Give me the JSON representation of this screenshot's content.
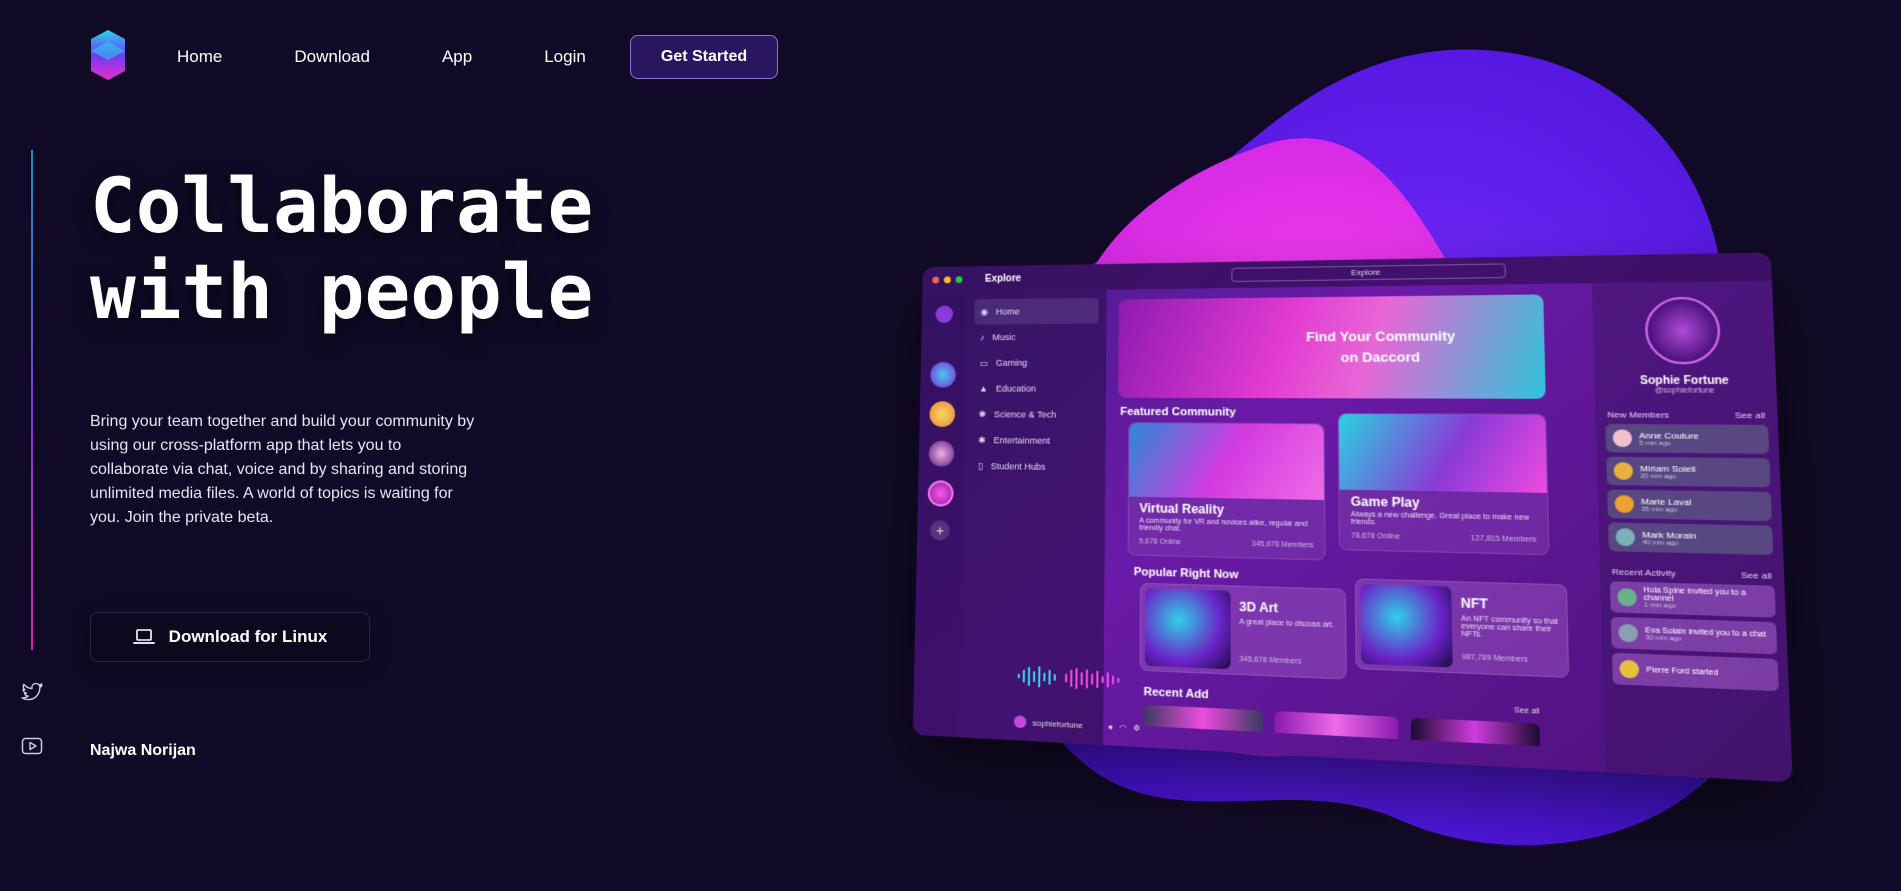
{
  "nav": {
    "items": [
      "Home",
      "Download",
      "App",
      "Login"
    ],
    "cta": "Get Started"
  },
  "hero": {
    "title_line1": "Collaborate",
    "title_line2": "with people",
    "description": "Bring your team together and build your community by using our cross-platform app that lets you to collaborate via chat, voice and by sharing and storing unlimited media files. A world of topics is waiting for you. Join the private beta.",
    "download_label": "Download for Linux",
    "author": "Najwa Norijan"
  },
  "app": {
    "window_title": "Explore",
    "search_placeholder": "Explore",
    "channels": [
      "Home",
      "Music",
      "Gaming",
      "Education",
      "Science & Tech",
      "Entertainment",
      "Student Hubs"
    ],
    "banner_line1": "Find Your Community",
    "banner_line2": "on Daccord",
    "featured_title": "Featured Community",
    "featured": [
      {
        "name": "Virtual Reality",
        "desc": "A community for VR and novices alike, regular and friendly chat.",
        "online": "5,678 Online",
        "members": "345,678 Members"
      },
      {
        "name": "Game Play",
        "desc": "Always a new challenge. Great place to make new friends.",
        "online": "78,678 Online",
        "members": "127,815 Members"
      }
    ],
    "popular_title": "Popular Right Now",
    "popular": [
      {
        "name": "3D Art",
        "desc": "A great place to discuss art.",
        "members": "345,678 Members"
      },
      {
        "name": "NFT",
        "desc": "An NFT community so that everyone can share their NFTs.",
        "members": "987,789 Members"
      }
    ],
    "recent_add_title": "Recent Add",
    "see_all": "See all",
    "username": "sophiefortune",
    "profile_name": "Sophie Fortune",
    "profile_handle": "@sophiefortune",
    "new_members_title": "New Members",
    "members": [
      {
        "name": "Anne Couture",
        "time": "5 min ago"
      },
      {
        "name": "Miriam Soleil",
        "time": "20 min ago"
      },
      {
        "name": "Marie Laval",
        "time": "35 min ago"
      },
      {
        "name": "Mark Morain",
        "time": "40 min ago"
      }
    ],
    "recent_activity_title": "Recent Activity",
    "activities": [
      {
        "text": "Hola Spine invited you to a channel",
        "time": "1 min ago"
      },
      {
        "text": "Eva Solain invited you to a chat",
        "time": "30 min ago"
      },
      {
        "text": "Pierre Ford started",
        "time": ""
      }
    ]
  },
  "colors": {
    "background": "#110a26",
    "accent": "#2a1560",
    "blob_purple": "#6a1cf0",
    "blob_pink": "#f02ad8"
  }
}
